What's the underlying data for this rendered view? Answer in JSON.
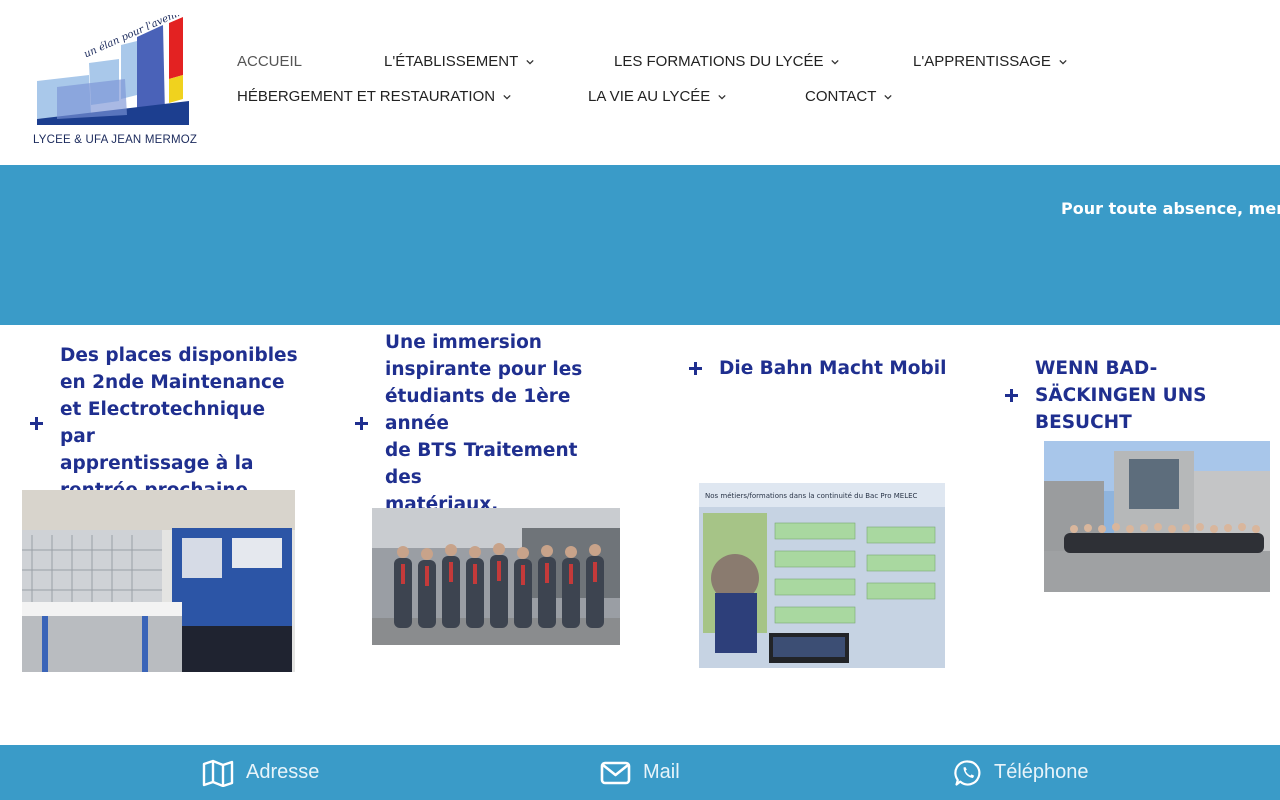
{
  "logo": {
    "slogan": "un élan pour l'avenir",
    "name": "LYCEE & UFA JEAN MERMOZ"
  },
  "nav": {
    "row1": [
      {
        "label": "ACCUEIL",
        "active": true,
        "dropdown": false
      },
      {
        "label": "L'ÉTABLISSEMENT",
        "dropdown": true
      },
      {
        "label": "LES FORMATIONS DU LYCÉE",
        "dropdown": true
      },
      {
        "label": "L'APPRENTISSAGE",
        "dropdown": true
      }
    ],
    "row2": [
      {
        "label": "HÉBERGEMENT ET RESTAURATION",
        "dropdown": true
      },
      {
        "label": "LA VIE AU LYCÉE",
        "dropdown": true
      },
      {
        "label": "CONTACT",
        "dropdown": true
      }
    ]
  },
  "banner": {
    "ticker": "Pour toute absence, merci"
  },
  "news": [
    {
      "lines": [
        "Des places disponibles",
        "en 2nde Maintenance",
        "et Electrotechnique par",
        "apprentissage à la",
        "rentrée prochaine"
      ],
      "image": "workshop-photo"
    },
    {
      "lines": [
        "Une immersion",
        "inspirante pour les",
        "étudiants de 1ère année",
        "de BTS Traitement des",
        "matériaux."
      ],
      "image": "students-group-photo"
    },
    {
      "lines": [
        "Die Bahn Macht Mobil"
      ],
      "image": "presentation-slide-photo",
      "slide_title": "Nos métiers/formations dans la continuité du Bac Pro MELEC"
    },
    {
      "lines": [
        "WENN BAD-",
        "SÄCKINGEN UNS",
        "BESUCHT"
      ],
      "image": "school-visit-photo"
    }
  ],
  "footer": {
    "address": "Adresse",
    "mail": "Mail",
    "phone": "Téléphone"
  },
  "colors": {
    "brand_blue": "#3a9bc8",
    "title_blue": "#1f2f8f"
  }
}
